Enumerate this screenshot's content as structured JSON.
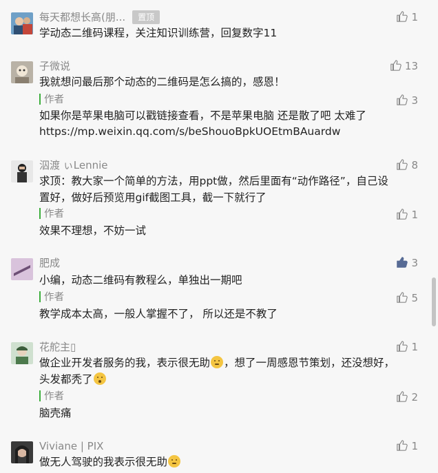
{
  "comments": [
    {
      "name": "每天都想长高(朋...",
      "badge": "置顶",
      "likes": "1",
      "text": "学动态二维码课程，关注知识训练营，回复数字11"
    },
    {
      "name": "子微说",
      "likes": "13",
      "text": "我就想问最后那个动态的二维码是怎么搞的，感恩！",
      "author_label": "作者",
      "author_likes": "3",
      "reply_line1": "如果你是苹果电脑可以戳链接查看，不是苹果电脑 还是散了吧  太难了",
      "reply_line2": "https://mp.weixin.qq.com/s/beShouoBpkUOEtmBAuardw"
    },
    {
      "name": "泅渡 ぃLennie",
      "likes": "8",
      "text_line1": "求顶：教大家一个简单的方法，用ppt做，然后里面有“动作路径”，自己设",
      "text_line2": "置好，做好后预览用gif截图工具，截一下就行了",
      "author_label": "作者",
      "author_likes": "1",
      "reply": "效果不理想，不妨一试"
    },
    {
      "name": "肥成",
      "likes": "3",
      "liked": true,
      "text": "小编，动态二维码有教程么，单独出一期吧",
      "author_label": "作者",
      "author_likes": "5",
      "reply": "教学成本太高，一般人掌握不了，  所以还是不教了"
    },
    {
      "name": "花舵主▯",
      "likes": "1",
      "text_line1_a": "做企业开发者服务的我，表示很无助",
      "text_line1_b": "，想了一周感恩节策划，还没想好，",
      "text_line2": "头发都秃了",
      "author_label": "作者",
      "author_likes": "2",
      "reply": "脑壳痛"
    },
    {
      "name": "Viviane | PIX",
      "likes": "1",
      "text": "做无人驾驶的我表示很无助"
    }
  ],
  "colors": {
    "accent": "#3cae3c",
    "meta": "#888888",
    "liked": "#576b95"
  }
}
